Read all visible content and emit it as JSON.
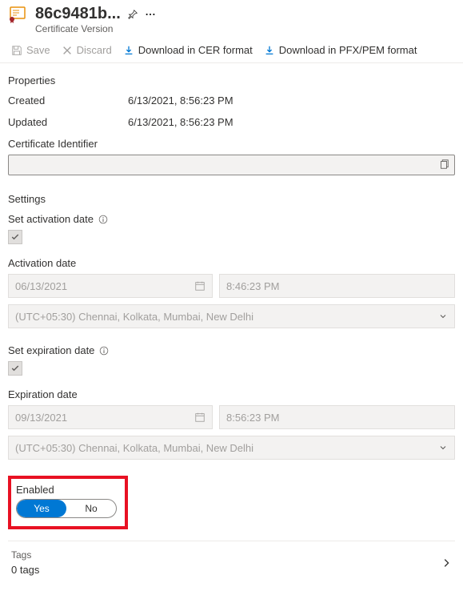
{
  "header": {
    "title": "86c9481b...",
    "subtitle": "Certificate Version"
  },
  "toolbar": {
    "save": "Save",
    "discard": "Discard",
    "download_cer": "Download in CER format",
    "download_pfx": "Download in PFX/PEM format"
  },
  "properties": {
    "heading": "Properties",
    "created_label": "Created",
    "created_value": "6/13/2021, 8:56:23 PM",
    "updated_label": "Updated",
    "updated_value": "6/13/2021, 8:56:23 PM",
    "identifier_label": "Certificate Identifier"
  },
  "settings": {
    "heading": "Settings",
    "activation_toggle_label": "Set activation date",
    "activation_label": "Activation date",
    "activation_date": "06/13/2021",
    "activation_time": "8:46:23 PM",
    "activation_tz": "(UTC+05:30) Chennai, Kolkata, Mumbai, New Delhi",
    "expiration_toggle_label": "Set expiration date",
    "expiration_label": "Expiration date",
    "expiration_date": "09/13/2021",
    "expiration_time": "8:56:23 PM",
    "expiration_tz": "(UTC+05:30) Chennai, Kolkata, Mumbai, New Delhi",
    "enabled_label": "Enabled",
    "enabled_yes": "Yes",
    "enabled_no": "No"
  },
  "tags": {
    "label": "Tags",
    "count": "0 tags"
  }
}
